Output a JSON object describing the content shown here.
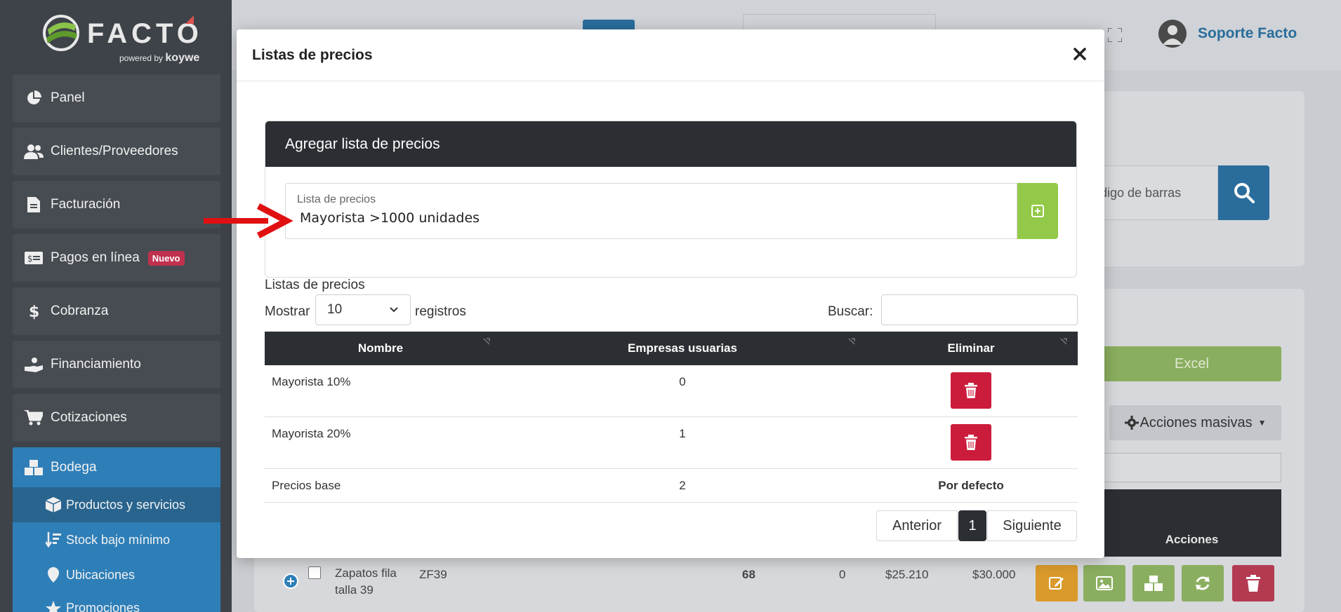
{
  "brand": {
    "name": "FACTO",
    "powered_by": "powered by",
    "partner": "koywe"
  },
  "sidebar": {
    "items": [
      {
        "label": "Panel",
        "icon": "pie-chart-icon"
      },
      {
        "label": "Clientes/Proveedores",
        "icon": "users-icon"
      },
      {
        "label": "Facturación",
        "icon": "document-icon"
      },
      {
        "label": "Pagos en línea",
        "icon": "money-bill-icon",
        "badge": "Nuevo"
      },
      {
        "label": "Cobranza",
        "icon": "dollar-icon"
      },
      {
        "label": "Financiamiento",
        "icon": "hand-coin-icon"
      },
      {
        "label": "Cotizaciones",
        "icon": "cart-icon"
      },
      {
        "label": "Bodega",
        "icon": "boxes-icon"
      }
    ],
    "subitems": [
      {
        "label": "Productos y servicios",
        "icon": "box-icon"
      },
      {
        "label": "Stock bajo mínimo",
        "icon": "sort-amount-icon"
      },
      {
        "label": "Ubicaciones",
        "icon": "map-pin-icon"
      },
      {
        "label": "Promociones",
        "icon": "star-icon"
      }
    ]
  },
  "header": {
    "user_name": "Soporte Facto"
  },
  "background": {
    "search_placeholder": "digo de barras",
    "excel_label": "Excel",
    "mass_actions_label": "Acciones masivas",
    "actions_header": "Acciones",
    "row": {
      "name": "Zapatos fila talla 39",
      "code": "ZF39",
      "stock": "68",
      "reserved": "0",
      "cost": "$25.210",
      "price": "$30.000"
    }
  },
  "modal": {
    "title": "Listas de precios",
    "panel_title": "Agregar lista de precios",
    "field_label": "Lista de precios",
    "field_value": "Mayorista >1000 unidades",
    "section_title": "Listas de precios",
    "show_label": "Mostrar",
    "show_value": "10",
    "records_label": "registros",
    "search_label": "Buscar:",
    "columns": [
      "Nombre",
      "Empresas usuarias",
      "Eliminar"
    ],
    "rows": [
      {
        "name": "Mayorista 10%",
        "companies": "0",
        "deletable": true
      },
      {
        "name": "Mayorista 20%",
        "companies": "1",
        "deletable": true
      },
      {
        "name": "Precios base",
        "companies": "2",
        "deletable": false,
        "default_label": "Por defecto"
      }
    ],
    "pagination": {
      "prev": "Anterior",
      "current": "1",
      "next": "Siguiente"
    }
  },
  "colors": {
    "accent_blue": "#2e7fb8",
    "success_green": "#93c948",
    "danger_red": "#cc1c3c",
    "dark_header": "#2b2f33",
    "arrow_red": "#e01010"
  }
}
